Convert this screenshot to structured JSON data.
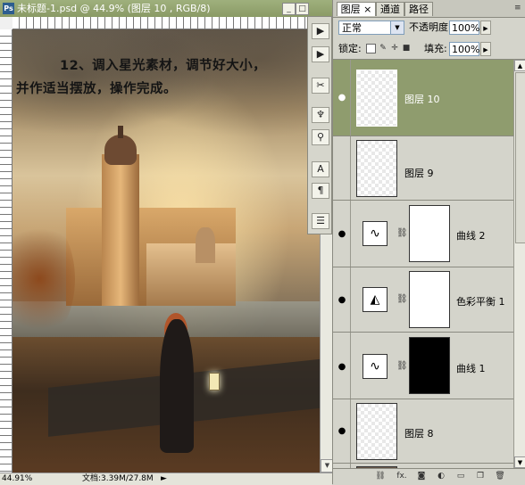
{
  "document": {
    "title": "未标题-1.psd @ 44.9% (图层 10 , RGB/8)",
    "app_icon": "Ps",
    "window_buttons": [
      "minimize-icon",
      "maximize-icon",
      "close-icon"
    ],
    "canvas_text": {
      "line1": "12、调入星光素材，调节好大小，",
      "line2": "并作适当摆放，操作完成。"
    },
    "status": {
      "zoom": "44.91%",
      "doc_size": "文档:3.39M/27.8M",
      "arrow": "►"
    }
  },
  "tools_strip": {
    "icons": [
      "play-icon",
      "play-icon",
      "brush-settings-icon",
      "brushes-icon",
      "stamp-icon",
      "character-icon",
      "paragraph-icon",
      "layer-comps-icon"
    ]
  },
  "layers_panel": {
    "tabs": [
      {
        "label": "图层",
        "active": true
      },
      {
        "label": "通道",
        "active": false
      },
      {
        "label": "路径",
        "active": false
      }
    ],
    "close_tab_glyph": "×",
    "menu_glyph": "≡",
    "blend_mode": "正常",
    "opacity_label": "不透明度:",
    "opacity_value": "100%",
    "lock_label": "锁定:",
    "fill_label": "填充:",
    "fill_value": "100%",
    "layers": [
      {
        "name": "图层 10",
        "kind": "pixel",
        "selected": true
      },
      {
        "name": "图层 9",
        "kind": "pixel",
        "selected": false
      },
      {
        "name": "曲线 2",
        "kind": "curves",
        "mask": "white",
        "selected": false
      },
      {
        "name": "色彩平衡 1",
        "kind": "color-balance",
        "mask": "white",
        "selected": false
      },
      {
        "name": "曲线 1",
        "kind": "curves",
        "mask": "black",
        "selected": false
      },
      {
        "name": "图层 8",
        "kind": "pixel",
        "selected": false
      }
    ],
    "footer_icons": [
      "link-layers-icon",
      "fx-icon",
      "add-mask-icon",
      "adjustment-layer-icon",
      "group-icon",
      "new-layer-icon",
      "trash-icon"
    ],
    "footer_fx": "fx."
  }
}
